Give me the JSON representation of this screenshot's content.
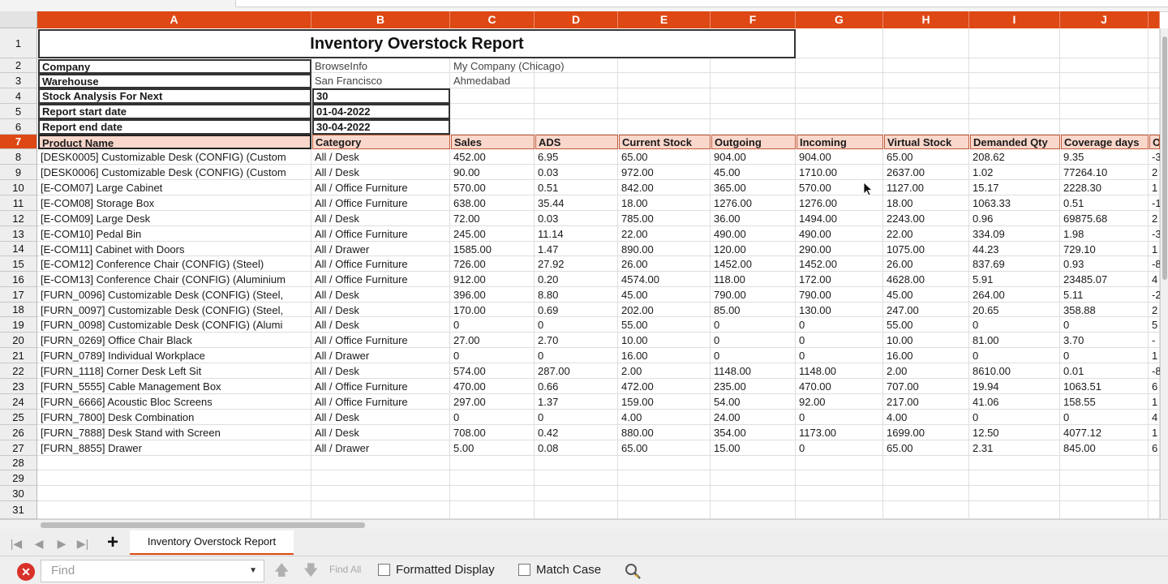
{
  "sheet": {
    "columns": [
      "A",
      "B",
      "C",
      "D",
      "E",
      "F",
      "G",
      "H",
      "I",
      "J"
    ],
    "rows": [
      1,
      2,
      3,
      4,
      5,
      6,
      7,
      8,
      9,
      10,
      11,
      12,
      13,
      14,
      15,
      16,
      17,
      18,
      19,
      20,
      21,
      22,
      23,
      24,
      25,
      26,
      27,
      28,
      29,
      30,
      31
    ],
    "active_row": 7,
    "title": "Inventory Overstock Report",
    "info": {
      "company_label": "Company",
      "company_value1": "BrowseInfo",
      "company_value2": "My Company (Chicago)",
      "warehouse_label": "Warehouse",
      "warehouse_value1": "San Francisco",
      "warehouse_value2": "Ahmedabad",
      "stock_label": "Stock Analysis For Next",
      "stock_value": "30",
      "start_label": "Report start date",
      "start_value": "01-04-2022",
      "end_label": "Report end date",
      "end_value": "30-04-2022"
    },
    "headers": [
      "Product Name",
      "Category",
      "Sales",
      "ADS",
      "Current Stock",
      "Outgoing",
      "Incoming",
      "Virtual Stock",
      "Demanded Qty",
      "Coverage days",
      "O"
    ],
    "data_rows": [
      [
        "[DESK0005] Customizable Desk (CONFIG) (Custom",
        "All / Desk",
        "452.00",
        "6.95",
        "65.00",
        "904.00",
        "904.00",
        "65.00",
        "208.62",
        "9.35",
        "-3"
      ],
      [
        "[DESK0006] Customizable Desk (CONFIG) (Custom",
        "All / Desk",
        "90.00",
        "0.03",
        "972.00",
        "45.00",
        "1710.00",
        "2637.00",
        "1.02",
        "77264.10",
        "2"
      ],
      [
        "[E-COM07] Large Cabinet",
        "All / Office Furniture",
        "570.00",
        "0.51",
        "842.00",
        "365.00",
        "570.00",
        "1127.00",
        "15.17",
        "2228.30",
        "1"
      ],
      [
        "[E-COM08] Storage Box",
        "All / Office Furniture",
        "638.00",
        "35.44",
        "18.00",
        "1276.00",
        "1276.00",
        "18.00",
        "1063.33",
        "0.51",
        "-1"
      ],
      [
        "[E-COM09] Large Desk",
        "All / Desk",
        "72.00",
        "0.03",
        "785.00",
        "36.00",
        "1494.00",
        "2243.00",
        "0.96",
        "69875.68",
        "2"
      ],
      [
        "[E-COM10] Pedal Bin",
        "All / Office Furniture",
        "245.00",
        "11.14",
        "22.00",
        "490.00",
        "490.00",
        "22.00",
        "334.09",
        "1.98",
        "-3"
      ],
      [
        "[E-COM11] Cabinet with Doors",
        "All / Drawer",
        "1585.00",
        "1.47",
        "890.00",
        "120.00",
        "290.00",
        "1075.00",
        "44.23",
        "729.10",
        "1"
      ],
      [
        "[E-COM12] Conference Chair (CONFIG) (Steel)",
        "All / Office Furniture",
        "726.00",
        "27.92",
        "26.00",
        "1452.00",
        "1452.00",
        "26.00",
        "837.69",
        "0.93",
        "-8"
      ],
      [
        "[E-COM13] Conference Chair (CONFIG) (Aluminium",
        "All / Office Furniture",
        "912.00",
        "0.20",
        "4574.00",
        "118.00",
        "172.00",
        "4628.00",
        "5.91",
        "23485.07",
        "4"
      ],
      [
        "[FURN_0096] Customizable Desk (CONFIG) (Steel,",
        "All / Desk",
        "396.00",
        "8.80",
        "45.00",
        "790.00",
        "790.00",
        "45.00",
        "264.00",
        "5.11",
        "-2"
      ],
      [
        "[FURN_0097] Customizable Desk (CONFIG) (Steel,",
        "All / Desk",
        "170.00",
        "0.69",
        "202.00",
        "85.00",
        "130.00",
        "247.00",
        "20.65",
        "358.88",
        "2"
      ],
      [
        "[FURN_0098] Customizable Desk (CONFIG) (Alumi",
        "All / Desk",
        "0",
        "0",
        "55.00",
        "0",
        "0",
        "55.00",
        "0",
        "0",
        "5"
      ],
      [
        "[FURN_0269] Office Chair Black",
        "All / Office Furniture",
        "27.00",
        "2.70",
        "10.00",
        "0",
        "0",
        "10.00",
        "81.00",
        "3.70",
        "-"
      ],
      [
        "[FURN_0789] Individual Workplace",
        "All / Drawer",
        "0",
        "0",
        "16.00",
        "0",
        "0",
        "16.00",
        "0",
        "0",
        "1"
      ],
      [
        "[FURN_1118] Corner Desk Left Sit",
        "All / Desk",
        "574.00",
        "287.00",
        "2.00",
        "1148.00",
        "1148.00",
        "2.00",
        "8610.00",
        "0.01",
        "-8"
      ],
      [
        "[FURN_5555] Cable Management Box",
        "All / Office Furniture",
        "470.00",
        "0.66",
        "472.00",
        "235.00",
        "470.00",
        "707.00",
        "19.94",
        "1063.51",
        "6"
      ],
      [
        "[FURN_6666] Acoustic Bloc Screens",
        "All / Office Furniture",
        "297.00",
        "1.37",
        "159.00",
        "54.00",
        "92.00",
        "217.00",
        "41.06",
        "158.55",
        "1"
      ],
      [
        "[FURN_7800] Desk Combination",
        "All / Desk",
        "0",
        "0",
        "4.00",
        "24.00",
        "0",
        "4.00",
        "0",
        "0",
        "4"
      ],
      [
        "[FURN_7888] Desk Stand with Screen",
        "All / Desk",
        "708.00",
        "0.42",
        "880.00",
        "354.00",
        "1173.00",
        "1699.00",
        "12.50",
        "4077.12",
        "1"
      ],
      [
        "[FURN_8855] Drawer",
        "All / Drawer",
        "5.00",
        "0.08",
        "65.00",
        "15.00",
        "0",
        "65.00",
        "2.31",
        "845.00",
        "6"
      ]
    ]
  },
  "tabs": {
    "sheet_tab": "Inventory Overstock Report",
    "add_symbol": "+"
  },
  "findbar": {
    "placeholder": "Find",
    "find_all": "Find All",
    "formatted_display": "Formatted Display",
    "match_case": "Match Case"
  },
  "colors": {
    "accent": "#dd4814",
    "header_fill": "#fad7cb"
  }
}
